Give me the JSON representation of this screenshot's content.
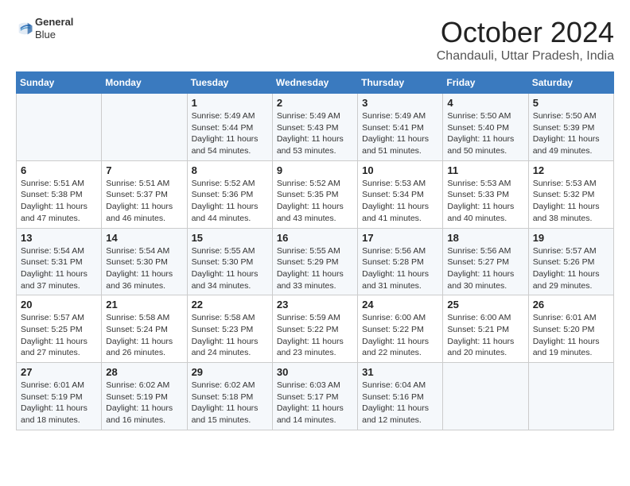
{
  "logo": {
    "line1": "General",
    "line2": "Blue"
  },
  "title": "October 2024",
  "location": "Chandauli, Uttar Pradesh, India",
  "days_header": [
    "Sunday",
    "Monday",
    "Tuesday",
    "Wednesday",
    "Thursday",
    "Friday",
    "Saturday"
  ],
  "weeks": [
    [
      {
        "num": "",
        "info": ""
      },
      {
        "num": "",
        "info": ""
      },
      {
        "num": "1",
        "info": "Sunrise: 5:49 AM\nSunset: 5:44 PM\nDaylight: 11 hours and 54 minutes."
      },
      {
        "num": "2",
        "info": "Sunrise: 5:49 AM\nSunset: 5:43 PM\nDaylight: 11 hours and 53 minutes."
      },
      {
        "num": "3",
        "info": "Sunrise: 5:49 AM\nSunset: 5:41 PM\nDaylight: 11 hours and 51 minutes."
      },
      {
        "num": "4",
        "info": "Sunrise: 5:50 AM\nSunset: 5:40 PM\nDaylight: 11 hours and 50 minutes."
      },
      {
        "num": "5",
        "info": "Sunrise: 5:50 AM\nSunset: 5:39 PM\nDaylight: 11 hours and 49 minutes."
      }
    ],
    [
      {
        "num": "6",
        "info": "Sunrise: 5:51 AM\nSunset: 5:38 PM\nDaylight: 11 hours and 47 minutes."
      },
      {
        "num": "7",
        "info": "Sunrise: 5:51 AM\nSunset: 5:37 PM\nDaylight: 11 hours and 46 minutes."
      },
      {
        "num": "8",
        "info": "Sunrise: 5:52 AM\nSunset: 5:36 PM\nDaylight: 11 hours and 44 minutes."
      },
      {
        "num": "9",
        "info": "Sunrise: 5:52 AM\nSunset: 5:35 PM\nDaylight: 11 hours and 43 minutes."
      },
      {
        "num": "10",
        "info": "Sunrise: 5:53 AM\nSunset: 5:34 PM\nDaylight: 11 hours and 41 minutes."
      },
      {
        "num": "11",
        "info": "Sunrise: 5:53 AM\nSunset: 5:33 PM\nDaylight: 11 hours and 40 minutes."
      },
      {
        "num": "12",
        "info": "Sunrise: 5:53 AM\nSunset: 5:32 PM\nDaylight: 11 hours and 38 minutes."
      }
    ],
    [
      {
        "num": "13",
        "info": "Sunrise: 5:54 AM\nSunset: 5:31 PM\nDaylight: 11 hours and 37 minutes."
      },
      {
        "num": "14",
        "info": "Sunrise: 5:54 AM\nSunset: 5:30 PM\nDaylight: 11 hours and 36 minutes."
      },
      {
        "num": "15",
        "info": "Sunrise: 5:55 AM\nSunset: 5:30 PM\nDaylight: 11 hours and 34 minutes."
      },
      {
        "num": "16",
        "info": "Sunrise: 5:55 AM\nSunset: 5:29 PM\nDaylight: 11 hours and 33 minutes."
      },
      {
        "num": "17",
        "info": "Sunrise: 5:56 AM\nSunset: 5:28 PM\nDaylight: 11 hours and 31 minutes."
      },
      {
        "num": "18",
        "info": "Sunrise: 5:56 AM\nSunset: 5:27 PM\nDaylight: 11 hours and 30 minutes."
      },
      {
        "num": "19",
        "info": "Sunrise: 5:57 AM\nSunset: 5:26 PM\nDaylight: 11 hours and 29 minutes."
      }
    ],
    [
      {
        "num": "20",
        "info": "Sunrise: 5:57 AM\nSunset: 5:25 PM\nDaylight: 11 hours and 27 minutes."
      },
      {
        "num": "21",
        "info": "Sunrise: 5:58 AM\nSunset: 5:24 PM\nDaylight: 11 hours and 26 minutes."
      },
      {
        "num": "22",
        "info": "Sunrise: 5:58 AM\nSunset: 5:23 PM\nDaylight: 11 hours and 24 minutes."
      },
      {
        "num": "23",
        "info": "Sunrise: 5:59 AM\nSunset: 5:22 PM\nDaylight: 11 hours and 23 minutes."
      },
      {
        "num": "24",
        "info": "Sunrise: 6:00 AM\nSunset: 5:22 PM\nDaylight: 11 hours and 22 minutes."
      },
      {
        "num": "25",
        "info": "Sunrise: 6:00 AM\nSunset: 5:21 PM\nDaylight: 11 hours and 20 minutes."
      },
      {
        "num": "26",
        "info": "Sunrise: 6:01 AM\nSunset: 5:20 PM\nDaylight: 11 hours and 19 minutes."
      }
    ],
    [
      {
        "num": "27",
        "info": "Sunrise: 6:01 AM\nSunset: 5:19 PM\nDaylight: 11 hours and 18 minutes."
      },
      {
        "num": "28",
        "info": "Sunrise: 6:02 AM\nSunset: 5:19 PM\nDaylight: 11 hours and 16 minutes."
      },
      {
        "num": "29",
        "info": "Sunrise: 6:02 AM\nSunset: 5:18 PM\nDaylight: 11 hours and 15 minutes."
      },
      {
        "num": "30",
        "info": "Sunrise: 6:03 AM\nSunset: 5:17 PM\nDaylight: 11 hours and 14 minutes."
      },
      {
        "num": "31",
        "info": "Sunrise: 6:04 AM\nSunset: 5:16 PM\nDaylight: 11 hours and 12 minutes."
      },
      {
        "num": "",
        "info": ""
      },
      {
        "num": "",
        "info": ""
      }
    ]
  ]
}
